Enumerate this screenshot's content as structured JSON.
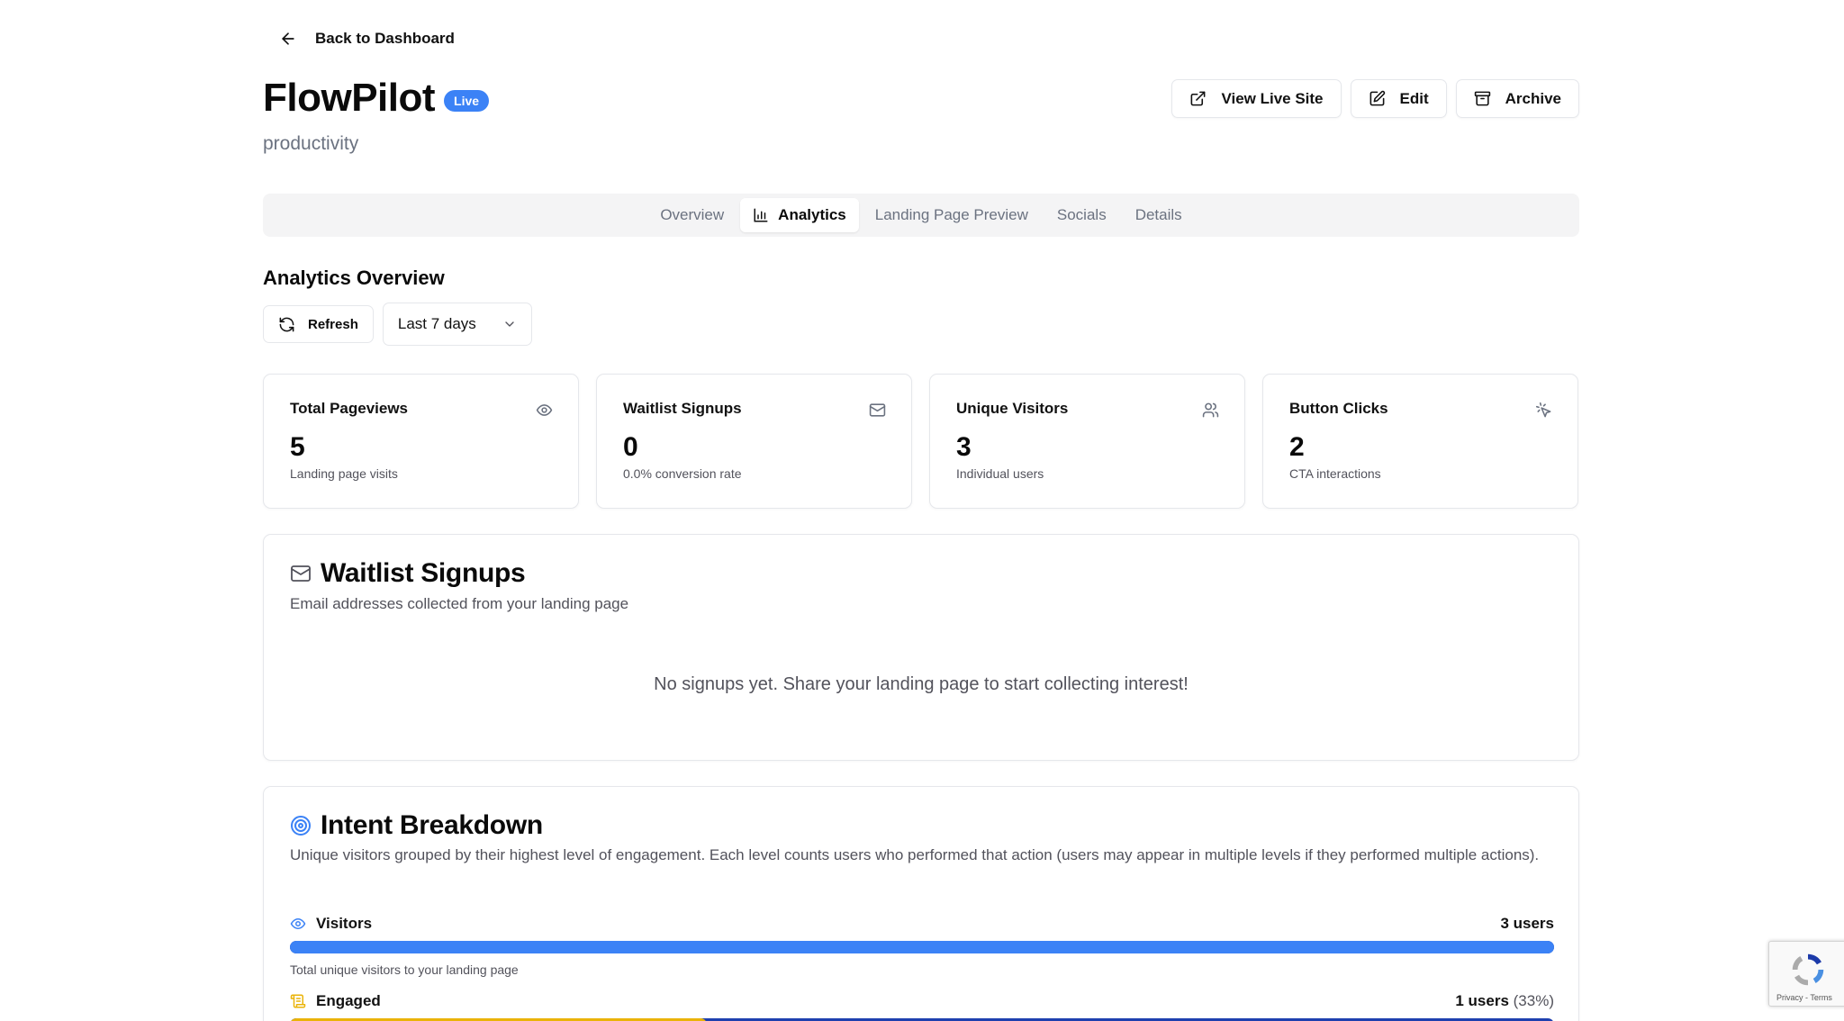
{
  "nav": {
    "back_label": "Back to Dashboard"
  },
  "project": {
    "name": "FlowPilot",
    "status": "Live",
    "category": "productivity"
  },
  "actions": {
    "view_live": "View Live Site",
    "edit": "Edit",
    "archive": "Archive"
  },
  "tabs": [
    {
      "label": "Overview"
    },
    {
      "label": "Analytics",
      "active": true
    },
    {
      "label": "Landing Page Preview"
    },
    {
      "label": "Socials"
    },
    {
      "label": "Details"
    }
  ],
  "analytics": {
    "title": "Analytics Overview",
    "refresh_label": "Refresh",
    "range_selected": "Last 7 days"
  },
  "stats": [
    {
      "label": "Total Pageviews",
      "value": "5",
      "sub": "Landing page visits",
      "icon": "eye-icon"
    },
    {
      "label": "Waitlist Signups",
      "value": "0",
      "sub": "0.0% conversion rate",
      "icon": "mail-icon"
    },
    {
      "label": "Unique Visitors",
      "value": "3",
      "sub": "Individual users",
      "icon": "users-icon"
    },
    {
      "label": "Button Clicks",
      "value": "2",
      "sub": "CTA interactions",
      "icon": "pointer-click-icon"
    }
  ],
  "signups": {
    "title": "Waitlist Signups",
    "description": "Email addresses collected from your landing page",
    "empty_message": "No signups yet. Share your landing page to start collecting interest!"
  },
  "intent": {
    "title": "Intent Breakdown",
    "description": "Unique visitors grouped by their highest level of engagement. Each level counts users who performed that action (users may appear in multiple levels if they performed multiple actions).",
    "levels": [
      {
        "name": "Visitors",
        "count": "3 users",
        "pct": "",
        "note": "Total unique visitors to your landing page",
        "fraction": 1.0,
        "color": "#3b82f6"
      },
      {
        "name": "Engaged",
        "count": "1 users",
        "pct": "(33%)",
        "note": "",
        "fraction": 0.33,
        "color": "#eab308"
      }
    ]
  },
  "recaptcha": {
    "text": "Privacy - Terms"
  },
  "colors": {
    "accent": "#3b82f6",
    "engaged": "#eab308",
    "bar_track": "#1e40af"
  }
}
